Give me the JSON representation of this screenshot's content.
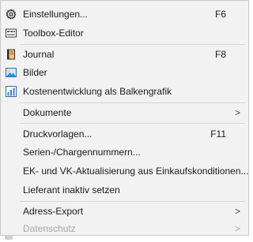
{
  "menu": {
    "items": [
      {
        "label": "Einstellungen...",
        "shortcut": "F6",
        "icon": "gear-icon"
      },
      {
        "label": "Toolbox-Editor",
        "shortcut": "",
        "icon": "toolbox-icon"
      },
      {
        "label": "Journal",
        "shortcut": "F8",
        "icon": "journal-icon"
      },
      {
        "label": "Bilder",
        "shortcut": "",
        "icon": "image-icon"
      },
      {
        "label": "Kostenentwicklung als Balkengrafik",
        "shortcut": "",
        "icon": "bar-chart-icon"
      },
      {
        "label": "Dokumente",
        "submenu_arrow": ">"
      },
      {
        "label": "Druckvorlagen...",
        "shortcut": "F11"
      },
      {
        "label": "Serien-/Chargennummern..."
      },
      {
        "label": "EK- und VK-Aktualisierung aus Einkaufskonditionen..."
      },
      {
        "label": "Lieferant inaktiv setzen"
      },
      {
        "label": "Adress-Export",
        "submenu_arrow": ">"
      },
      {
        "label": "Datenschutz",
        "submenu_arrow": ">",
        "disabled": true
      }
    ]
  },
  "colors": {
    "menu_background": "#f2f2f2",
    "text": "#1a1a1a",
    "disabled_text": "#a7a7a7",
    "separator": "#d6d6d6"
  }
}
